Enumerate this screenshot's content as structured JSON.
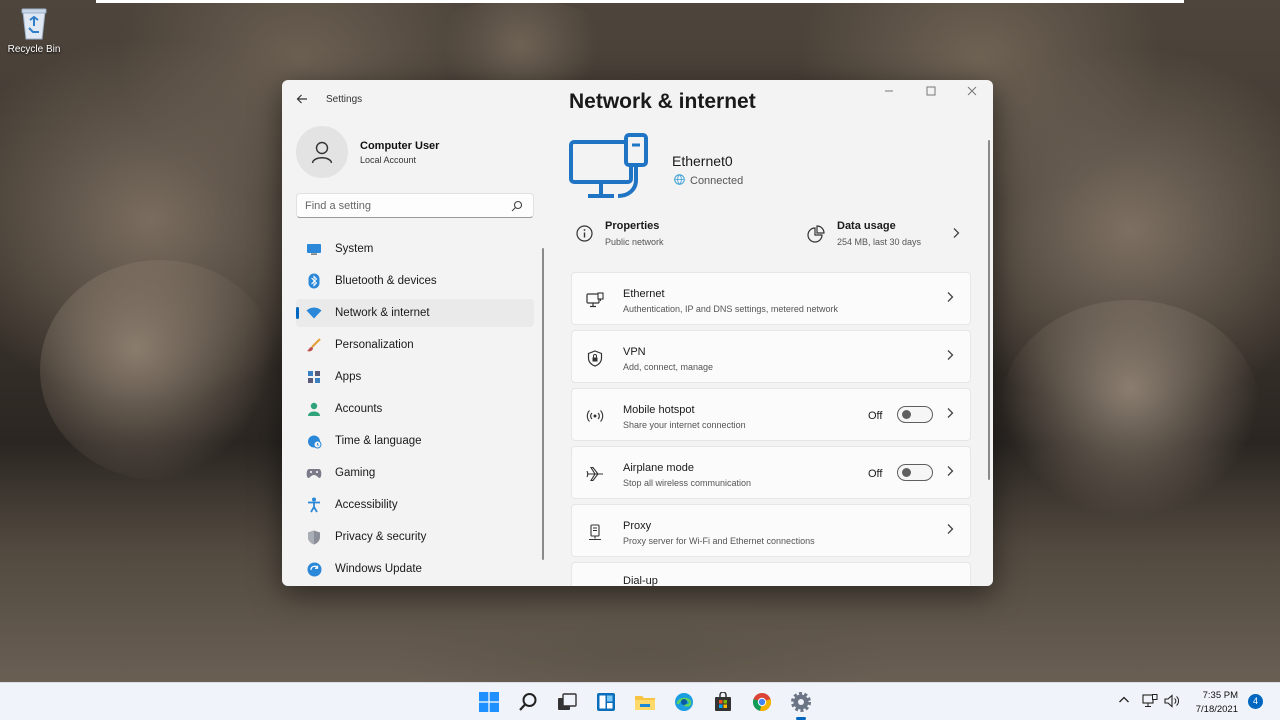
{
  "desktop": {
    "recycle_bin_label": "Recycle Bin"
  },
  "window": {
    "title": "Settings",
    "back_icon": "back-arrow-icon",
    "controls": [
      "minimize",
      "maximize",
      "close"
    ]
  },
  "user": {
    "name": "Computer User",
    "account_type": "Local Account"
  },
  "search": {
    "placeholder": "Find a setting"
  },
  "sidebar": {
    "items": [
      {
        "label": "System",
        "icon": "monitor-icon",
        "active": false
      },
      {
        "label": "Bluetooth & devices",
        "icon": "bluetooth-icon",
        "active": false
      },
      {
        "label": "Network & internet",
        "icon": "wifi-icon",
        "active": true
      },
      {
        "label": "Personalization",
        "icon": "brush-icon",
        "active": false
      },
      {
        "label": "Apps",
        "icon": "apps-icon",
        "active": false
      },
      {
        "label": "Accounts",
        "icon": "person-icon",
        "active": false
      },
      {
        "label": "Time & language",
        "icon": "globe-clock-icon",
        "active": false
      },
      {
        "label": "Gaming",
        "icon": "gamepad-icon",
        "active": false
      },
      {
        "label": "Accessibility",
        "icon": "accessibility-icon",
        "active": false
      },
      {
        "label": "Privacy & security",
        "icon": "shield-icon",
        "active": false
      },
      {
        "label": "Windows Update",
        "icon": "update-icon",
        "active": false
      }
    ]
  },
  "main": {
    "title": "Network & internet",
    "connection": {
      "name": "Ethernet0",
      "status": "Connected"
    },
    "properties": {
      "title": "Properties",
      "subtitle": "Public network"
    },
    "data_usage": {
      "title": "Data usage",
      "subtitle": "254 MB, last 30 days"
    },
    "cards": [
      {
        "title": "Ethernet",
        "subtitle": "Authentication, IP and DNS settings, metered network",
        "icon": "ethernet-icon"
      },
      {
        "title": "VPN",
        "subtitle": "Add, connect, manage",
        "icon": "vpn-shield-icon"
      },
      {
        "title": "Mobile hotspot",
        "subtitle": "Share your internet connection",
        "icon": "hotspot-icon",
        "toggle_label": "Off"
      },
      {
        "title": "Airplane mode",
        "subtitle": "Stop all wireless communication",
        "icon": "airplane-icon",
        "toggle_label": "Off"
      },
      {
        "title": "Proxy",
        "subtitle": "Proxy server for Wi-Fi and Ethernet connections",
        "icon": "proxy-icon"
      },
      {
        "title": "Dial-up",
        "subtitle": "",
        "icon": "dialup-icon"
      }
    ]
  },
  "taskbar": {
    "apps": [
      "start-icon",
      "search-icon",
      "task-view-icon",
      "widgets-icon",
      "file-explorer-icon",
      "edge-icon",
      "store-icon",
      "chrome-icon",
      "settings-icon"
    ],
    "time": "7:35 PM",
    "date": "7/18/2021",
    "notification_count": "4"
  }
}
